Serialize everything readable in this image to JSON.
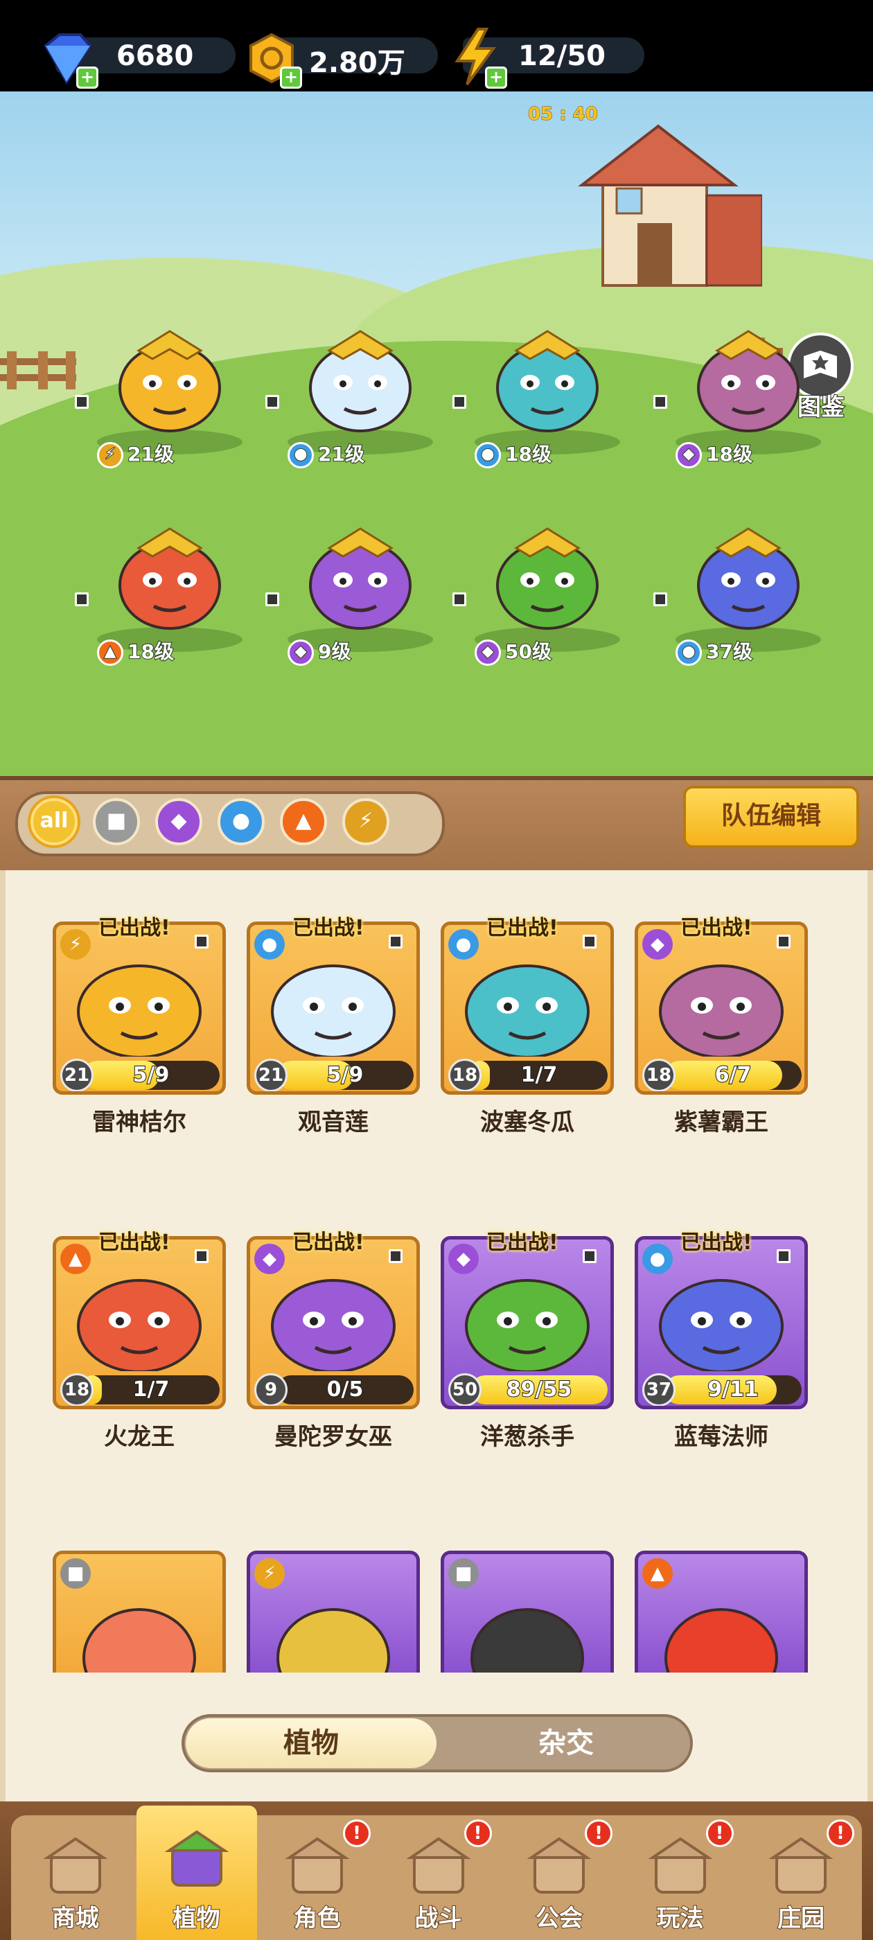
{
  "resources": {
    "gems": "6680",
    "coins": "2.80万",
    "energy": "12/50",
    "energy_timer": "05 : 40"
  },
  "pokedex_label": "图鉴",
  "lineup": [
    {
      "name": "雷神桔尔",
      "level_label": "21级",
      "element": "lightning"
    },
    {
      "name": "观音莲",
      "level_label": "21级",
      "element": "water"
    },
    {
      "name": "波塞冬瓜",
      "level_label": "18级",
      "element": "water"
    },
    {
      "name": "紫薯霸王",
      "level_label": "18级",
      "element": "poison"
    },
    {
      "name": "火龙王",
      "level_label": "18级",
      "element": "fire"
    },
    {
      "name": "曼陀罗女巫",
      "level_label": "9级",
      "element": "poison"
    },
    {
      "name": "洋葱杀手",
      "level_label": "50级",
      "element": "poison"
    },
    {
      "name": "蓝莓法师",
      "level_label": "37级",
      "element": "water"
    }
  ],
  "filters": [
    {
      "id": "all",
      "label": "all",
      "color": "#f2c230"
    },
    {
      "id": "physical",
      "label": "",
      "color": "#9a9a9a"
    },
    {
      "id": "poison",
      "label": "",
      "color": "#9b4fd6"
    },
    {
      "id": "water",
      "label": "",
      "color": "#3a9ae6"
    },
    {
      "id": "fire",
      "label": "",
      "color": "#f06a1a"
    },
    {
      "id": "lightning",
      "label": "",
      "color": "#e0a020"
    }
  ],
  "team_edit_label": "队伍编辑",
  "deployed_label": "已出战!",
  "cards": [
    {
      "name": "雷神桔尔",
      "level": "21",
      "progress": "5/9",
      "fill": 0.56,
      "rarity": "gold",
      "element": "lightning",
      "deployed": true
    },
    {
      "name": "观音莲",
      "level": "21",
      "progress": "5/9",
      "fill": 0.56,
      "rarity": "gold",
      "element": "water",
      "deployed": true
    },
    {
      "name": "波塞冬瓜",
      "level": "18",
      "progress": "1/7",
      "fill": 0.14,
      "rarity": "gold",
      "element": "water",
      "deployed": true
    },
    {
      "name": "紫薯霸王",
      "level": "18",
      "progress": "6/7",
      "fill": 0.86,
      "rarity": "gold",
      "element": "poison",
      "deployed": true
    },
    {
      "name": "火龙王",
      "level": "18",
      "progress": "1/7",
      "fill": 0.14,
      "rarity": "gold",
      "element": "fire",
      "deployed": true
    },
    {
      "name": "曼陀罗女巫",
      "level": "9",
      "progress": "0/5",
      "fill": 0.0,
      "rarity": "gold",
      "element": "poison",
      "deployed": true
    },
    {
      "name": "洋葱杀手",
      "level": "50",
      "progress": "89/55",
      "fill": 1.0,
      "rarity": "purple",
      "element": "poison",
      "deployed": true
    },
    {
      "name": "蓝莓法师",
      "level": "37",
      "progress": "9/11",
      "fill": 0.82,
      "rarity": "purple",
      "element": "water",
      "deployed": true
    }
  ],
  "partial_cards": [
    {
      "rarity": "gold",
      "element": "physical"
    },
    {
      "rarity": "purple",
      "element": "lightning"
    },
    {
      "rarity": "purple",
      "element": "physical"
    },
    {
      "rarity": "purple",
      "element": "fire"
    }
  ],
  "toggle": {
    "plants": "植物",
    "hybrid": "杂交"
  },
  "nav": [
    {
      "id": "shop",
      "label": "商城",
      "badge": false
    },
    {
      "id": "plants",
      "label": "植物",
      "badge": false,
      "active": true
    },
    {
      "id": "role",
      "label": "角色",
      "badge": true
    },
    {
      "id": "battle",
      "label": "战斗",
      "badge": true
    },
    {
      "id": "guild",
      "label": "公会",
      "badge": true
    },
    {
      "id": "play",
      "label": "玩法",
      "badge": true
    },
    {
      "id": "manor",
      "label": "庄园",
      "badge": true
    }
  ],
  "badge_mark": "!",
  "element_colors": {
    "lightning": "#e8a41e",
    "water": "#3a9ae6",
    "poison": "#9b4fd6",
    "fire": "#f06a1a",
    "physical": "#8f8f8f"
  }
}
